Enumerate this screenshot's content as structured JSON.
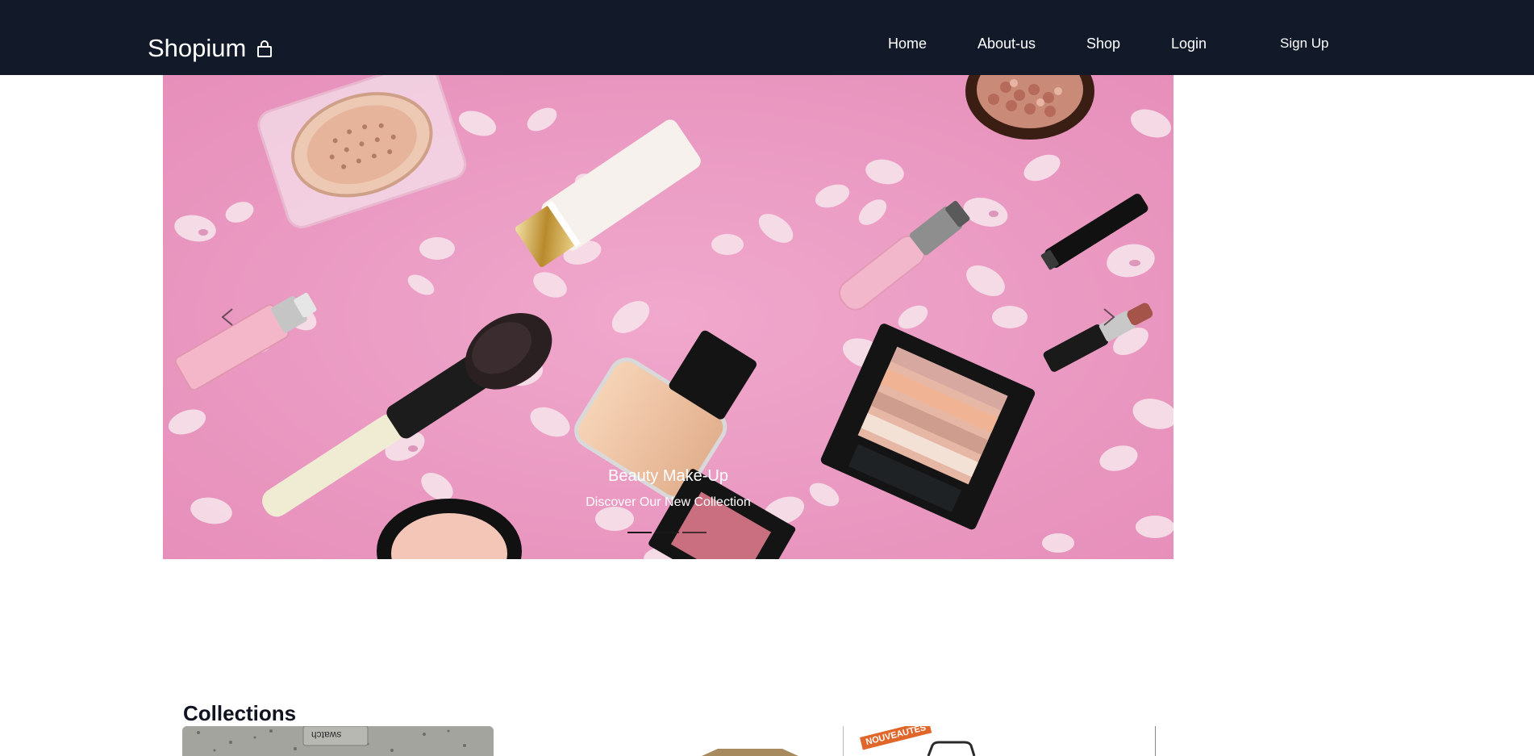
{
  "brand": {
    "name": "Shopium",
    "icon": "shopping-bag-icon"
  },
  "nav": {
    "items": [
      {
        "label": "Home"
      },
      {
        "label": "About-us"
      },
      {
        "label": "Shop"
      },
      {
        "label": "Login"
      },
      {
        "label": "Sign Up"
      }
    ]
  },
  "carousel": {
    "title": "Beauty Make-Up",
    "subtitle": "Discover Our New Collection",
    "slide_count": 3,
    "active_index": 0
  },
  "collections": {
    "heading": "Collections",
    "cards": [
      {
        "image_text": "swatch"
      },
      {
        "image_text": ""
      },
      {
        "badge": "NOUVEAUTÉS"
      }
    ]
  },
  "colors": {
    "navbar_bg": "#121a2a",
    "hero_bg": "#eb9cc4",
    "heading": "#0f1420",
    "badge": "#e0662a"
  }
}
